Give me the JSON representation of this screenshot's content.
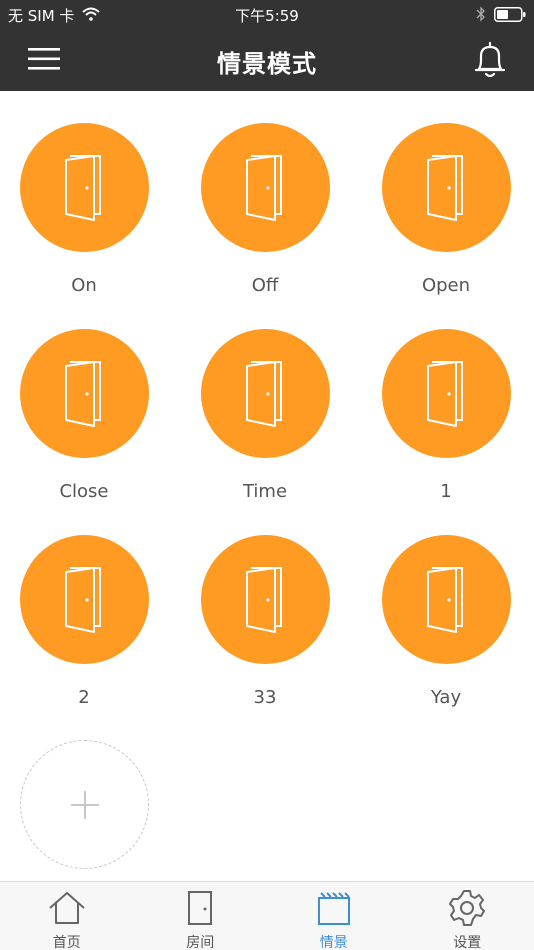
{
  "status_bar": {
    "carrier": "无 SIM 卡",
    "time": "下午5:59"
  },
  "header": {
    "title": "情景模式"
  },
  "scenes": [
    {
      "label": "On",
      "icon": "door-icon"
    },
    {
      "label": "Off",
      "icon": "door-icon"
    },
    {
      "label": "Open",
      "icon": "door-icon"
    },
    {
      "label": "Close",
      "icon": "door-icon"
    },
    {
      "label": "Time",
      "icon": "door-icon"
    },
    {
      "label": "1",
      "icon": "door-icon"
    },
    {
      "label": "2",
      "icon": "door-icon"
    },
    {
      "label": "33",
      "icon": "door-icon"
    },
    {
      "label": "Yay",
      "icon": "door-icon"
    }
  ],
  "tab_bar": {
    "tabs": [
      {
        "label": "首页",
        "icon": "home-icon"
      },
      {
        "label": "房间",
        "icon": "room-door-icon"
      },
      {
        "label": "情景",
        "icon": "scene-icon"
      },
      {
        "label": "设置",
        "icon": "gear-icon"
      }
    ],
    "active_index": 2
  },
  "colors": {
    "header_bg": "#333333",
    "scene_circle": "#ff9b22",
    "active_tab": "#3b8fd6"
  }
}
